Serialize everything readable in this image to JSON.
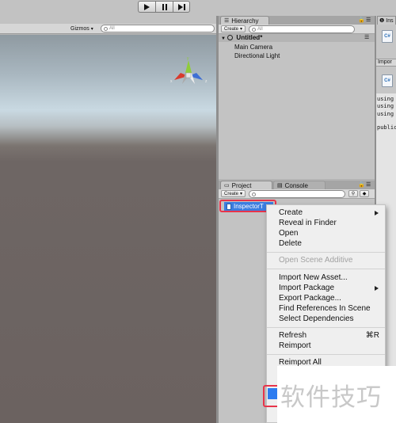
{
  "toolbar": {
    "play_icon": "play-icon",
    "pause_icon": "pause-icon",
    "step_icon": "step-icon"
  },
  "scene": {
    "gizmos_label": "Gizmos",
    "search_placeholder": "All",
    "axis": {
      "y": "y",
      "x": "x",
      "z": "z"
    }
  },
  "hierarchy": {
    "tab_label": "Hierarchy",
    "create_label": "Create",
    "search_placeholder": "All",
    "scene_name": "Untitled*",
    "items": [
      "Main Camera",
      "Directional Light"
    ]
  },
  "project": {
    "tab_project": "Project",
    "tab_console": "Console",
    "create_label": "Create",
    "selected_asset": "InspectorT"
  },
  "inspector": {
    "tab_label": "Ins",
    "import_label": "Impor",
    "code_lines": [
      "using",
      "using",
      "using",
      "",
      "public"
    ],
    "file_badge": "C#"
  },
  "context_menu": {
    "items": [
      {
        "label": "Create",
        "submenu": true
      },
      {
        "label": "Reveal in Finder"
      },
      {
        "label": "Open"
      },
      {
        "label": "Delete"
      },
      {
        "label": "Open Scene Additive",
        "disabled": true
      },
      {
        "label": "Import New Asset..."
      },
      {
        "label": "Import Package",
        "submenu": true
      },
      {
        "label": "Export Package..."
      },
      {
        "label": "Find References In Scene"
      },
      {
        "label": "Select Dependencies"
      },
      {
        "label": "Refresh",
        "shortcut": "⌘R"
      },
      {
        "label": "Reimport"
      },
      {
        "label": "Reimport All"
      }
    ]
  },
  "watermark": "软件技巧",
  "colors": {
    "selection": "#3c7de0",
    "highlight_box": "#e8344a"
  }
}
